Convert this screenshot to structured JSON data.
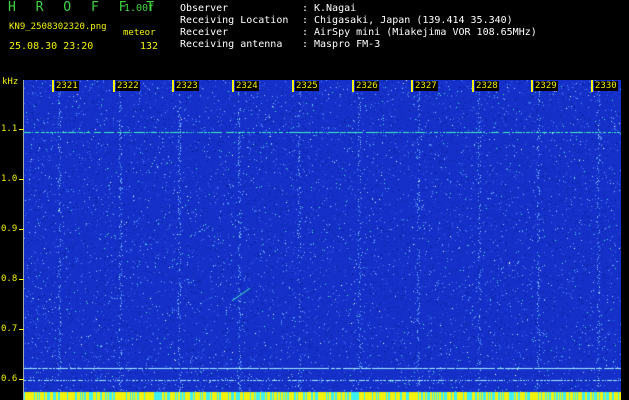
{
  "header": {
    "brand": "H R O F F T",
    "version": "1.00f",
    "filename": "KN9_2508302320.png",
    "meteor_label": "meteor",
    "datetime": "25.08.30 23:20",
    "meteor_count": "132"
  },
  "info": [
    {
      "label": "Observer",
      "value": "K.Nagai"
    },
    {
      "label": "Receiving Location",
      "value": "Chigasaki, Japan (139.414 35.340)"
    },
    {
      "label": "Receiver",
      "value": "AirSpy mini (Miakejima VOR 108.65MHz)"
    },
    {
      "label": "Receiving antenna",
      "value": "Maspro FM-3"
    }
  ],
  "spectrogram": {
    "y_unit": "kHz",
    "y_ticks": [
      "1.1",
      "1.0",
      "0.9",
      "0.8",
      "0.7",
      "0.6"
    ],
    "x_ticks": [
      "2321",
      "2322",
      "2323",
      "2324",
      "2325",
      "2326",
      "2327",
      "2328",
      "2329",
      "2330"
    ],
    "colors": {
      "background": "#1530c8",
      "noise": "#5aa0ff",
      "signal": "#3ff0c0",
      "axis_text": "#f2f20a"
    }
  }
}
